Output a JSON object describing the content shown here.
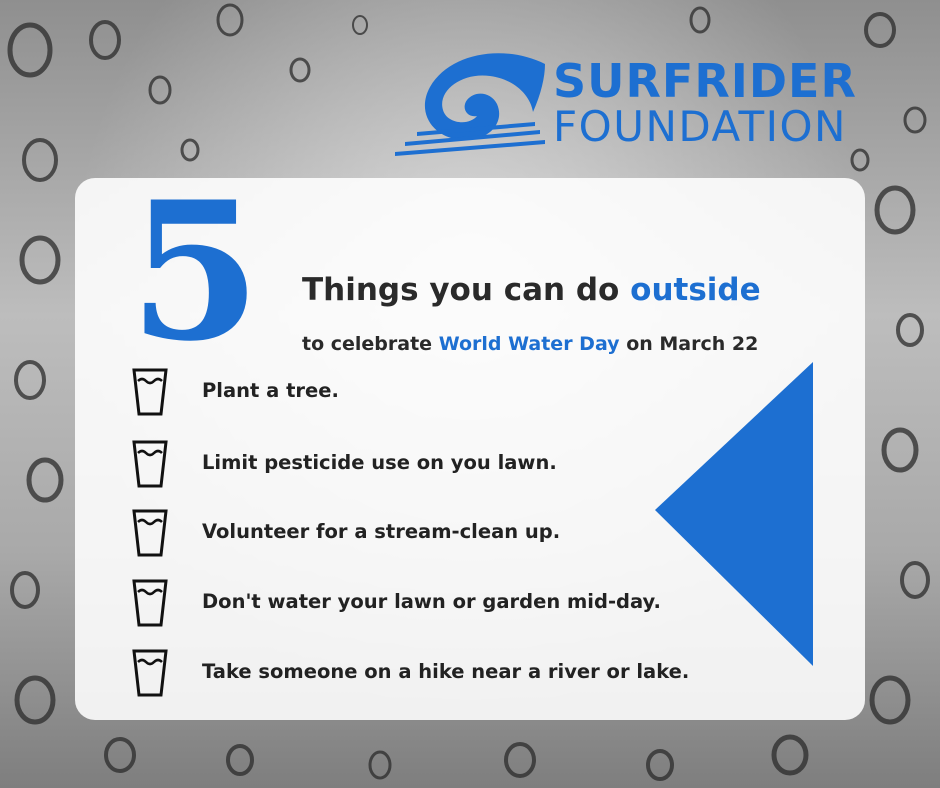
{
  "logo": {
    "line1": "SURFRIDER",
    "line2": "FOUNDATION",
    "mark": "wave-swirl-icon"
  },
  "big_number": "5",
  "headline": {
    "prefix": "Things you can do ",
    "accent": "outside"
  },
  "subline": {
    "prefix": "to celebrate ",
    "accent": "World Water Day",
    "suffix": " on March 22"
  },
  "items": [
    {
      "text": "Plant a tree.",
      "icon": "water-glass-icon"
    },
    {
      "text": "Limit pesticide use on you lawn.",
      "icon": "water-glass-icon"
    },
    {
      "text": "Volunteer for a stream-clean up.",
      "icon": "water-glass-icon"
    },
    {
      "text": "Don't water your lawn or garden mid-day.",
      "icon": "water-glass-icon"
    },
    {
      "text": "Take someone on a hike near a river or lake.",
      "icon": "water-glass-icon"
    }
  ],
  "colors": {
    "brand_blue": "#1d6fd1",
    "text_dark": "#222222",
    "card_bg": "#ffffff"
  }
}
